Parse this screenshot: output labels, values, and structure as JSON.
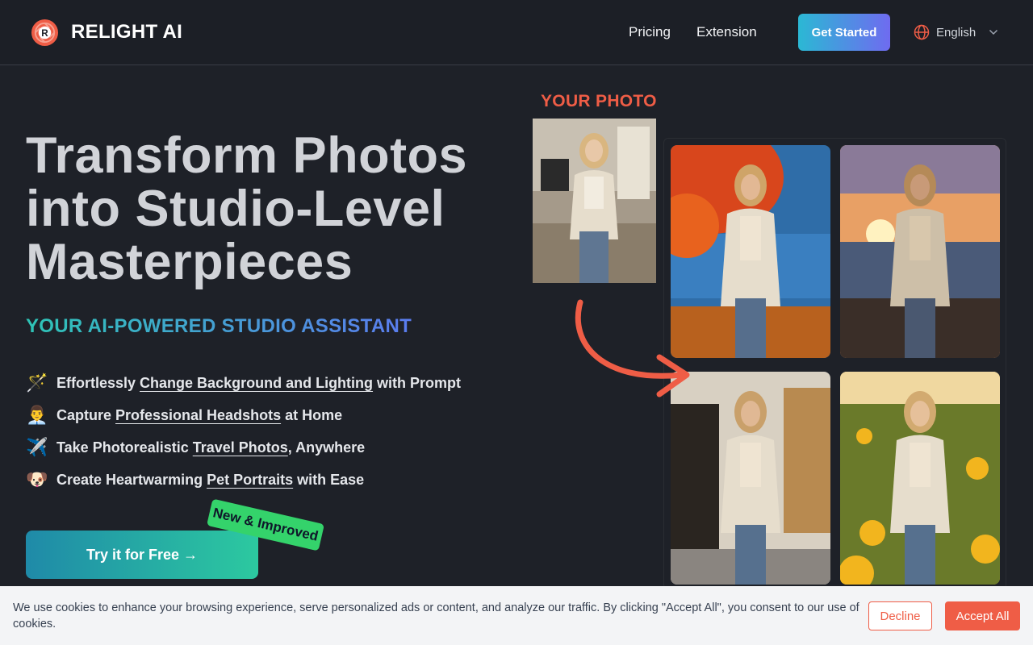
{
  "header": {
    "brand": "RELIGHT AI",
    "nav": [
      "Pricing",
      "Extension"
    ],
    "cta": "Get Started",
    "language": "English"
  },
  "hero": {
    "title_lines": [
      "Transform Photos",
      "into Studio-Level",
      "Masterpieces"
    ],
    "subtitle": "YOUR AI-POWERED STUDIO ASSISTANT",
    "features": [
      {
        "icon": "magic-wand-icon",
        "emoji": "🪄",
        "before": "Effortlessly ",
        "link": "Change Background and Lighting",
        "after": " with Prompt"
      },
      {
        "icon": "businessman-icon",
        "emoji": "👨‍💼",
        "before": "Capture ",
        "link": "Professional Headshots",
        "after": " at Home"
      },
      {
        "icon": "airplane-icon",
        "emoji": "✈️",
        "before": "Take Photorealistic ",
        "link": "Travel Photos",
        "after": ", Anywhere"
      },
      {
        "icon": "dog-face-icon",
        "emoji": "🐶",
        "before": "Create Heartwarming ",
        "link": "Pet Portraits",
        "after": " with Ease"
      }
    ],
    "try_button": "Try it for Free →",
    "badge": "New & Improved"
  },
  "showcase": {
    "your_photo_label": "YOUR PHOTO"
  },
  "cookie": {
    "text": "We use cookies to enhance your browsing experience, serve personalized ads or content, and analyze our traffic. By clicking \"Accept All\", you consent to our use of cookies.",
    "decline": "Decline",
    "accept": "Accept All"
  },
  "colors": {
    "background": "#1e2128",
    "accent": "#ef5d46",
    "badge": "#34d36b"
  }
}
